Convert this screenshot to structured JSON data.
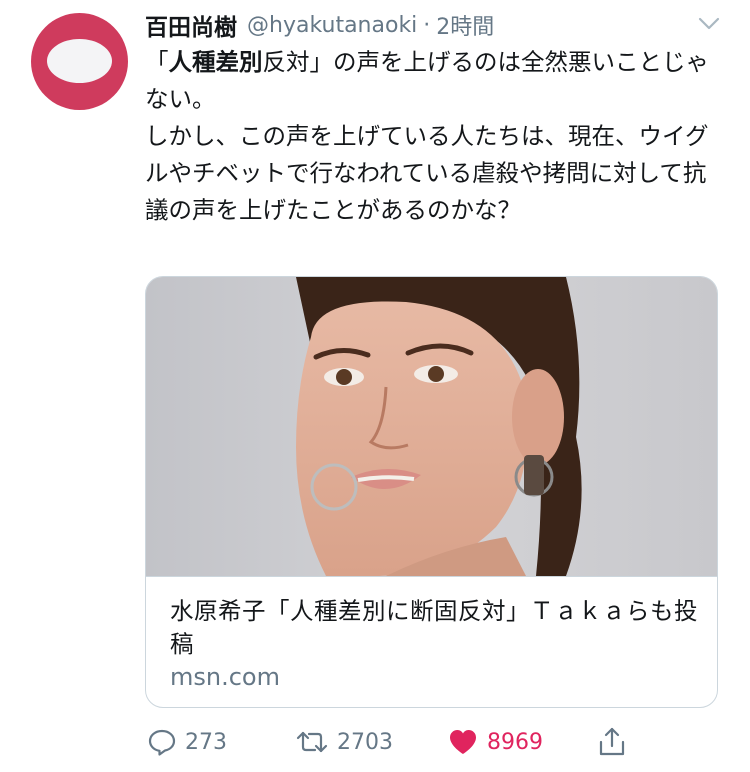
{
  "tweet": {
    "author_name": "百田尚樹",
    "handle": "@hyakutanaoki",
    "separator": "·",
    "time": "2時間",
    "text": {
      "line1_bracket_open": "「",
      "line1_bold": "人種差別",
      "line1_rest": "反対」の声を上げるのは全然悪いことじゃない。",
      "para2": "しかし、この声を上げている人たちは、現在、ウイグルやチベットで行なわれている虐殺や拷問に対して抗議の声を上げたことがあるのかな？"
    }
  },
  "card": {
    "title": "水原希子「人種差別に断固反対」Ｔａｋａらも投稿",
    "domain": "msn.com"
  },
  "actions": {
    "reply_count": "273",
    "retweet_count": "2703",
    "like_count": "8969"
  },
  "icons": {
    "avatar": "avatar-image",
    "menu": "chevron-down-icon",
    "reply": "speech-bubble-icon",
    "retweet": "retweet-icon",
    "like": "heart-icon",
    "share": "share-icon"
  },
  "colors": {
    "like_active": "#e0245e",
    "secondary_text": "#657786",
    "avatar_bg": "#cf3b5d"
  }
}
